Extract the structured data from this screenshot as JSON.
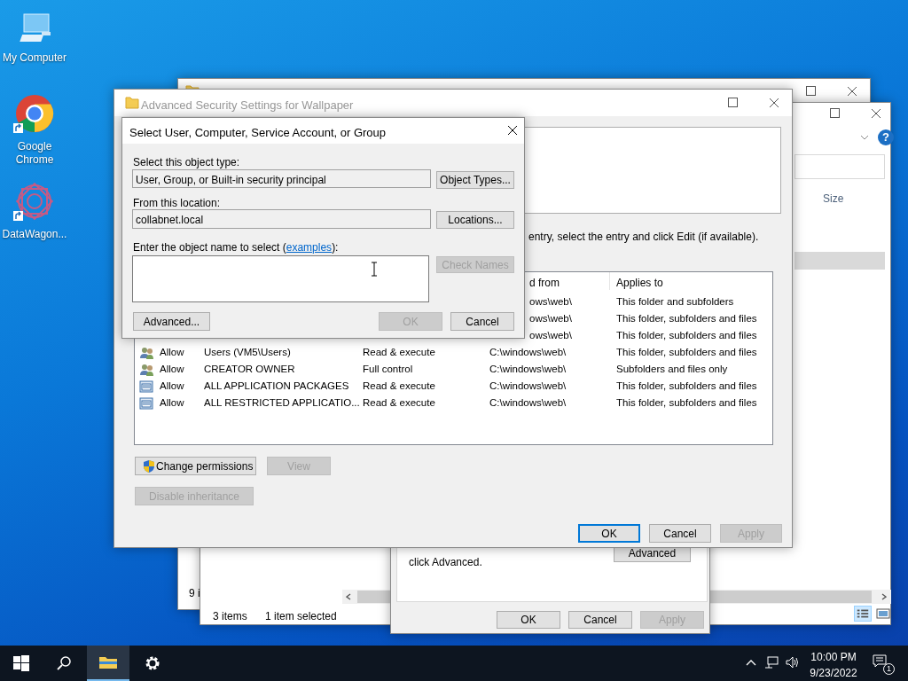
{
  "desktop_icons": [
    {
      "kind": "computer",
      "label": "My Computer"
    },
    {
      "kind": "chrome",
      "label": "Google Chrome",
      "shortcut": true
    },
    {
      "kind": "datawagon",
      "label": "DataWagon...",
      "shortcut": true
    }
  ],
  "explorer_back": {
    "status_text": "9 i"
  },
  "explorer": {
    "help": "?",
    "column_header": "Size",
    "item_count": "3 items",
    "selection": "1 item selected"
  },
  "properties": {
    "note": "click Advanced.",
    "advanced_button": "Advanced",
    "buttons": [
      {
        "label": "OK",
        "disabled": false
      },
      {
        "label": "Cancel",
        "disabled": false
      },
      {
        "label": "Apply",
        "disabled": true
      }
    ]
  },
  "security": {
    "title": "Advanced Security Settings for Wallpaper",
    "hint": "entry, select the entry and click Edit (if available).",
    "columns": [
      "d from",
      "Applies to"
    ],
    "entries": [
      {
        "kind": "partial",
        "inherited": "ows\\web\\",
        "applies": "This folder and subfolders"
      },
      {
        "kind": "partial",
        "inherited": "ows\\web\\",
        "applies": "This folder, subfolders and files"
      },
      {
        "kind": "partial",
        "inherited": "ows\\web\\",
        "applies": "This folder, subfolders and files"
      },
      {
        "kind": "user",
        "type": "Allow",
        "principal": "Users (VM5\\Users)",
        "access": "Read & execute",
        "inherited": "C:\\windows\\web\\",
        "applies": "This folder, subfolders and files"
      },
      {
        "kind": "user",
        "type": "Allow",
        "principal": "CREATOR OWNER",
        "access": "Full control",
        "inherited": "C:\\windows\\web\\",
        "applies": "Subfolders and files only"
      },
      {
        "kind": "package",
        "type": "Allow",
        "principal": "ALL APPLICATION PACKAGES",
        "access": "Read & execute",
        "inherited": "C:\\windows\\web\\",
        "applies": "This folder, subfolders and files"
      },
      {
        "kind": "package",
        "type": "Allow",
        "principal": "ALL RESTRICTED APPLICATIO...",
        "access": "Read & execute",
        "inherited": "C:\\windows\\web\\",
        "applies": "This folder, subfolders and files"
      }
    ],
    "actions": [
      {
        "label": "Change permissions",
        "disabled": false,
        "shield": true
      },
      {
        "label": "View",
        "disabled": true
      },
      {
        "label": "Disable inheritance",
        "disabled": true
      }
    ],
    "buttons": [
      {
        "label": "OK",
        "disabled": false,
        "default": true
      },
      {
        "label": "Cancel",
        "disabled": false,
        "default": false
      },
      {
        "label": "Apply",
        "disabled": true,
        "default": false
      }
    ]
  },
  "select_dialog": {
    "title": "Select User, Computer, Service Account, or Group",
    "object_type_label": "Select this object type:",
    "object_type": "User, Group, or Built-in security principal",
    "object_types_button": "Object Types...",
    "location_label": "From this location:",
    "location": "collabnet.local",
    "locations_button": "Locations...",
    "name_label": "Enter the object name to select (",
    "examples_link": "examples",
    "name_label_end": "):",
    "check_names": {
      "label": "Check Names",
      "disabled": true
    },
    "advanced": {
      "label": "Advanced...",
      "disabled": false
    },
    "ok": {
      "label": "OK",
      "disabled": true
    },
    "cancel": {
      "label": "Cancel",
      "disabled": false
    }
  },
  "taskbar": {
    "items": [
      {
        "kind": "start",
        "selected": false
      },
      {
        "kind": "search",
        "selected": false
      },
      {
        "kind": "explorer",
        "selected": true
      },
      {
        "kind": "settings",
        "selected": false
      }
    ],
    "time": "10:00 PM",
    "date": "9/23/2022",
    "notifications": "1"
  }
}
